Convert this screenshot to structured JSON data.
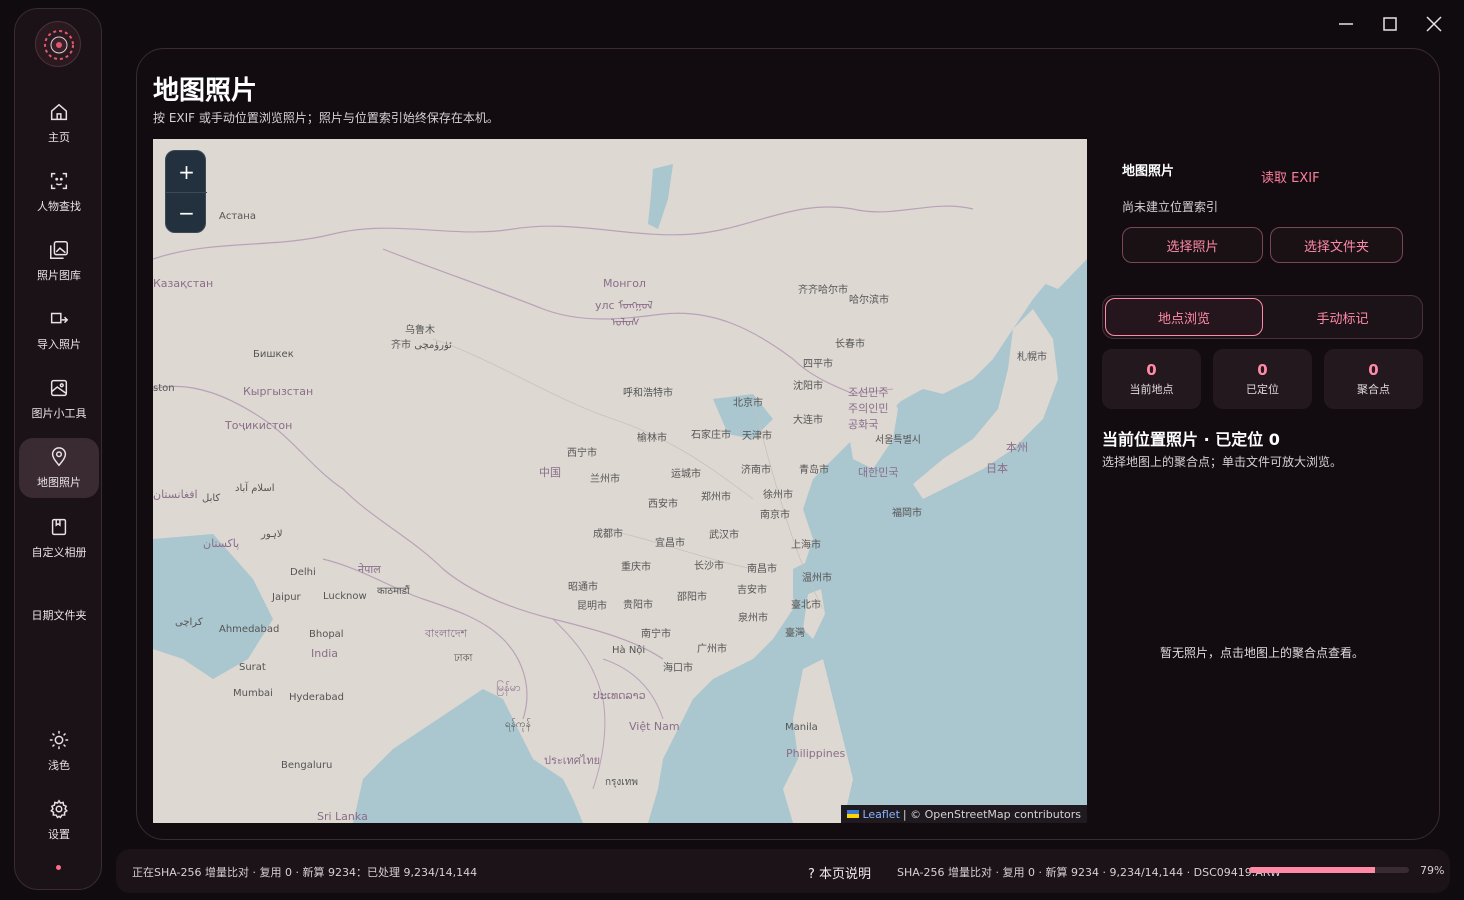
{
  "sidebar": {
    "items": [
      {
        "label": "主页",
        "icon": "home-icon"
      },
      {
        "label": "人物查找",
        "icon": "face-scan-icon"
      },
      {
        "label": "照片图库",
        "icon": "gallery-icon"
      },
      {
        "label": "导入照片",
        "icon": "import-icon"
      },
      {
        "label": "图片小工具",
        "icon": "image-tool-icon"
      },
      {
        "label": "地图照片",
        "icon": "map-pin-icon"
      },
      {
        "label": "自定义相册",
        "icon": "album-icon"
      },
      {
        "label": "日期文件夹",
        "icon": ""
      }
    ],
    "theme_label": "浅色",
    "settings_label": "设置"
  },
  "page": {
    "title": "地图照片",
    "subtitle": "按 EXIF 或手动位置浏览照片；照片与位置索引始终保存在本机。"
  },
  "map": {
    "zoom_in": "+",
    "zoom_out": "−",
    "attribution_leaflet": "Leaflet",
    "attribution_rest": "| © OpenStreetMap contributors",
    "labels": {
      "astana": "Астана",
      "kazakhstan": "Казақстан",
      "mongolia1": "Монгол",
      "mongolia2": "улс ᠮᠣᠩᠭᠣᠯ",
      "mongolia3": "ᠤᠯᠤᠰ",
      "urumqi1": "乌鲁木",
      "urumqi2": "齐市 ئۈرۈمچى",
      "bishkek": "Бишкек",
      "kyrgyz": "Кыргызстан",
      "tajik": "Тоҷикистон",
      "qiqihar": "齐齐哈尔市",
      "harbin": "哈尔滨市",
      "changchun": "长春市",
      "siping": "四平市",
      "shenyang": "沈阳市",
      "hohhot": "呼和浩特市",
      "beijing": "北京市",
      "dalian": "大连市",
      "nkorea": "조선민주주의인민공화국",
      "yulin": "榆林市",
      "shijiazhuang": "石家庄市",
      "tianjin": "天津市",
      "seoul": "서울특별시",
      "skorea": "대한민국",
      "xining": "西宁市",
      "lanzhou": "兰州市",
      "china": "中国",
      "yuncheng": "运城市",
      "jinan": "济南市",
      "qingdao": "青岛市",
      "xian": "西安市",
      "zhengzhou": "郑州市",
      "xuzhou": "徐州市",
      "nanjing": "南京市",
      "sapporo": "札幌市",
      "honshu": "本州",
      "japan": "日本",
      "fukuoka": "福岡市",
      "chengdu": "成都市",
      "yichang": "宜昌市",
      "wuhan": "武汉市",
      "shanghai": "上海市",
      "chongqing": "重庆市",
      "changsha": "长沙市",
      "nanchang": "南昌市",
      "wenzhou": "温州市",
      "zhaotong": "昭通市",
      "jian": "吉安市",
      "kunming": "昆明市",
      "guiyang": "贵阳市",
      "shaoyang": "邵阳市",
      "taibei": "臺北市",
      "quanzhou": "泉州市",
      "taiwan": "臺灣",
      "nanning": "南宁市",
      "guangzhou": "广州市",
      "hanoi": "Hà Nội",
      "haikou": "海口市",
      "delhi": "Delhi",
      "nepal": "नेपाल",
      "kathmandu": "काठमाडौं",
      "jaipur": "Jaipur",
      "lucknow": "Lucknow",
      "karachi": "کراچی",
      "ahmedabad": "Ahmedabad",
      "bhopal": "Bhopal",
      "india": "India",
      "bangladesh": "বাংলাদেশ",
      "dhaka": "ঢাকা",
      "surat": "Surat",
      "mumbai": "Mumbai",
      "hyderabad": "Hyderabad",
      "bengaluru": "Bengaluru",
      "srilanka": "Sri Lanka",
      "myanmar": "မြန်မာ",
      "yangon": "ရန်ကုန်",
      "laos": "ປະເທດລາວ",
      "vietnam": "Việt Nam",
      "thailand": "ประเทศไทย",
      "bangkok": "กรุงเทพ",
      "manila": "Manila",
      "philippines": "Philippines",
      "islamabad": "اسلام آباد",
      "kabul": "کابل",
      "afghan": "افغانستان",
      "pakistan": "پاکستان",
      "lahore": "لاہور",
      "tashkent": "ston"
    }
  },
  "right_panel": {
    "title": "地图照片",
    "read_exif": "读取 EXIF",
    "status": "尚未建立位置索引",
    "select_photos": "选择照片",
    "select_folder": "选择文件夹",
    "tabs": [
      "地点浏览",
      "手动标记"
    ],
    "stats": [
      {
        "value": "0",
        "label": "当前地点"
      },
      {
        "value": "0",
        "label": "已定位"
      },
      {
        "value": "0",
        "label": "聚合点"
      }
    ],
    "current_title": "当前位置照片 · 已定位 0",
    "current_hint": "选择地图上的聚合点；单击文件可放大浏览。",
    "empty_message": "暂无照片，点击地图上的聚合点查看。"
  },
  "bottom_bar": {
    "left_status": "正在SHA-256 增量比对 · 复用 0 · 新算 9234：已处理 9,234/14,144",
    "help": "? 本页说明",
    "right_status": "SHA-256 增量比对 · 复用 0 · 新算 9234 · 9,234/14,144 · DSC09419.ARW",
    "progress": 0.79,
    "progress_label": "79%"
  },
  "colors": {
    "accent": "#ff8aa8",
    "background": "#100b0e",
    "water": "#aac6cf",
    "land": "#ddd8d2"
  }
}
